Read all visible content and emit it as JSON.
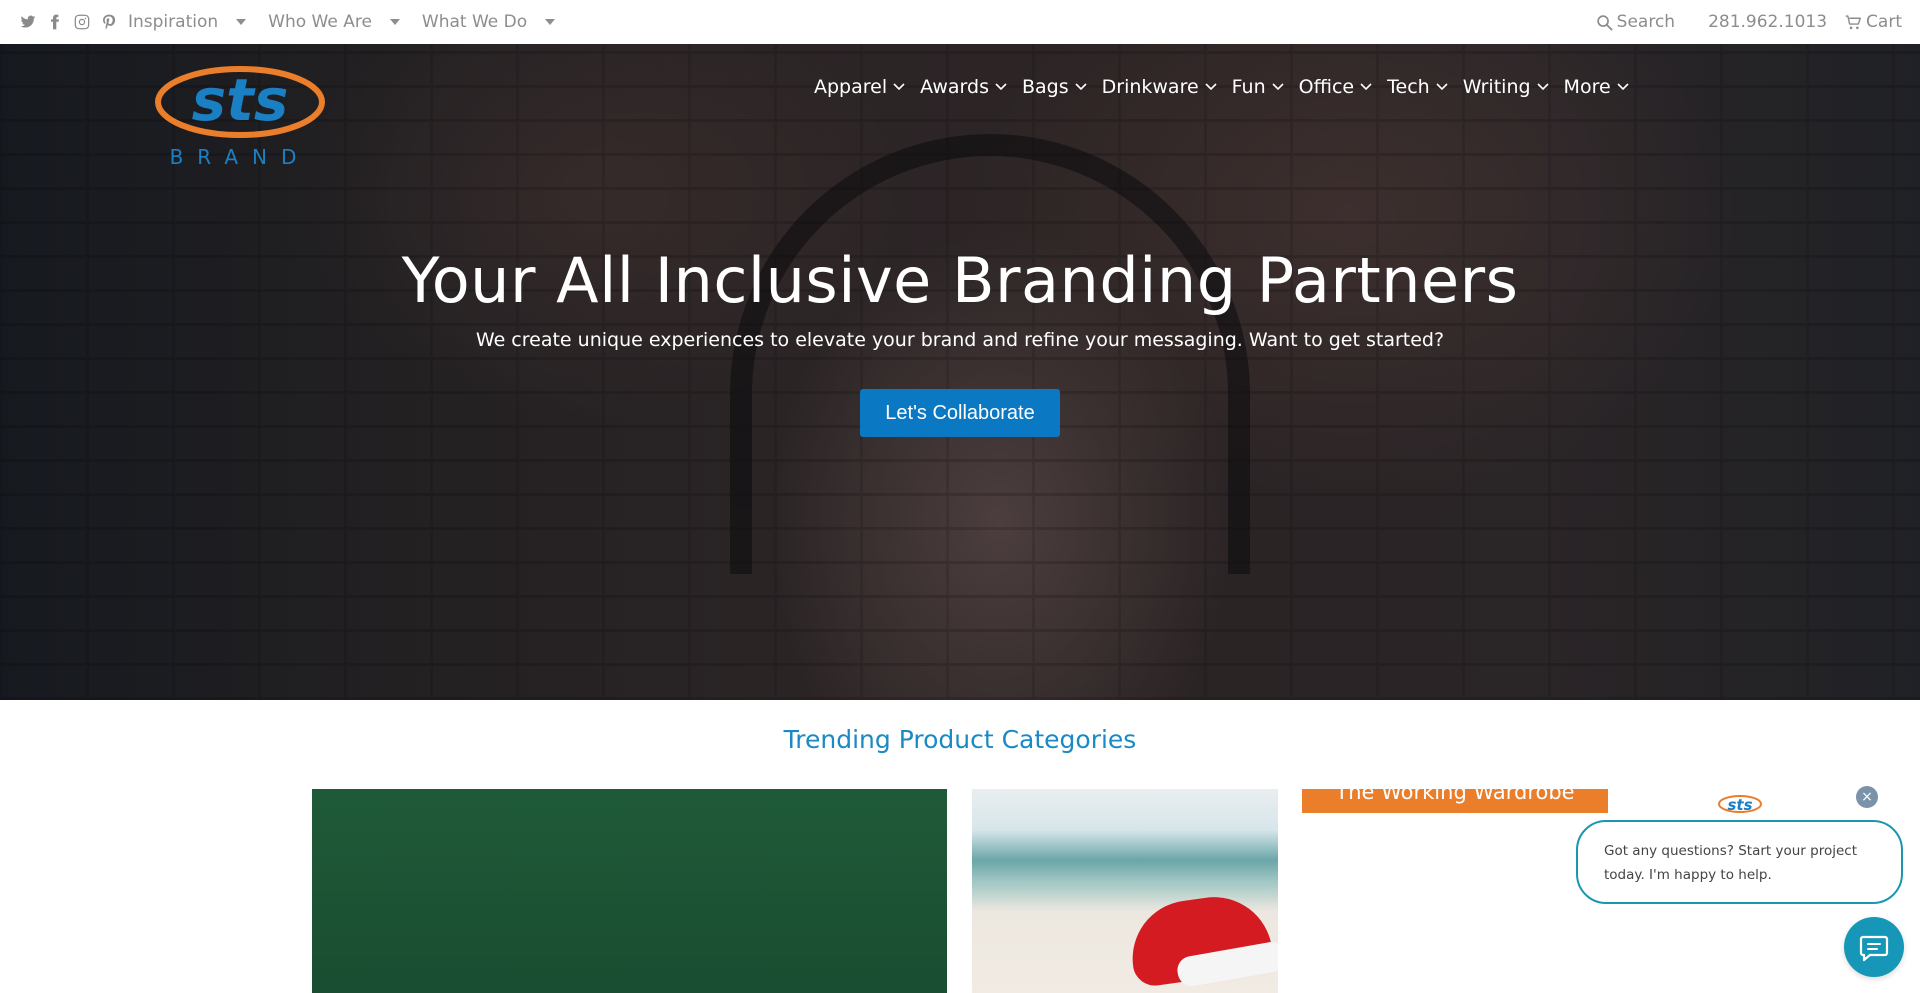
{
  "topbar": {
    "social": [
      {
        "name": "twitter-icon"
      },
      {
        "name": "facebook-icon"
      },
      {
        "name": "instagram-icon"
      },
      {
        "name": "pinterest-icon"
      }
    ],
    "nav": [
      {
        "label": "Inspiration"
      },
      {
        "label": "Who We Are"
      },
      {
        "label": "What We Do"
      }
    ],
    "search_label": "Search",
    "phone": "281.962.1013",
    "cart_label": "Cart"
  },
  "brand": {
    "logo_text": "sts",
    "logo_sub": "BRAND",
    "colors": {
      "orange": "#ea7e2a",
      "blue": "#1b7fc4"
    }
  },
  "mainnav": {
    "items": [
      {
        "label": "Apparel"
      },
      {
        "label": "Awards"
      },
      {
        "label": "Bags"
      },
      {
        "label": "Drinkware"
      },
      {
        "label": "Fun"
      },
      {
        "label": "Office"
      },
      {
        "label": "Tech"
      },
      {
        "label": "Writing"
      },
      {
        "label": "More"
      }
    ]
  },
  "hero": {
    "title": "Your All Inclusive Branding Partners",
    "subtitle": "We create unique experiences to elevate your brand and refine your messaging. Want to get started?",
    "cta_label": "Let's Collaborate",
    "cta_color": "#0a78c2"
  },
  "trending": {
    "title": "Trending Product Categories",
    "cards": [
      {
        "label": ""
      },
      {
        "label": ""
      },
      {
        "label": "The Working Wardrobe"
      }
    ]
  },
  "chat": {
    "message": "Got any questions? Start your project today. I'm happy to help.",
    "close_glyph": "×",
    "accent": "#1797b8"
  }
}
